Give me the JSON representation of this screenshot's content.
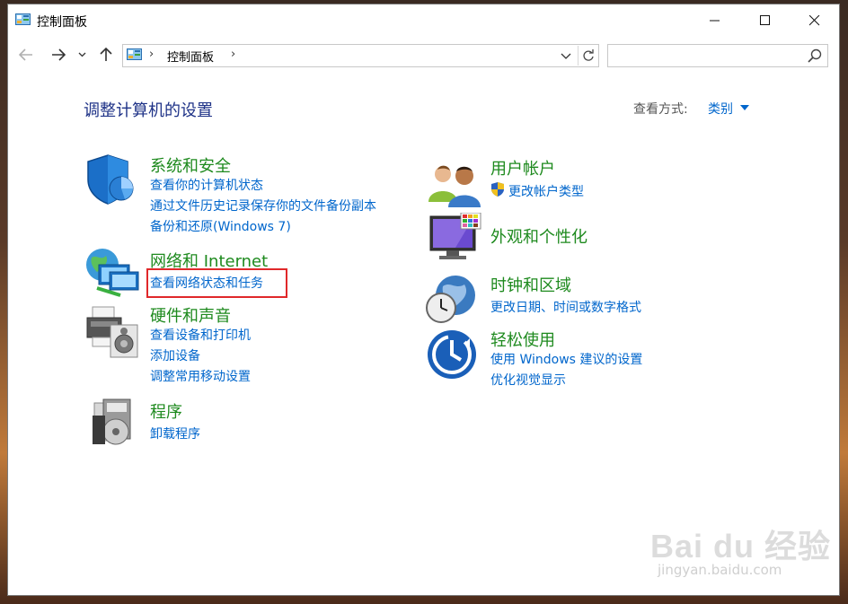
{
  "window": {
    "title": "控制面板"
  },
  "address": {
    "segment": "控制面板",
    "separator": "›"
  },
  "search": {
    "placeholder": ""
  },
  "main": {
    "heading": "调整计算机的设置",
    "view_by_label": "查看方式:",
    "view_by_value": "类别"
  },
  "categories": {
    "system": {
      "title": "系统和安全",
      "links": [
        "查看你的计算机状态",
        "通过文件历史记录保存你的文件备份副本",
        "备份和还原(Windows 7)"
      ]
    },
    "network": {
      "title": "网络和 Internet",
      "links": [
        "查看网络状态和任务"
      ]
    },
    "hardware": {
      "title": "硬件和声音",
      "links": [
        "查看设备和打印机",
        "添加设备",
        "调整常用移动设置"
      ]
    },
    "programs": {
      "title": "程序",
      "links": [
        "卸载程序"
      ]
    },
    "users": {
      "title": "用户帐户",
      "links": [
        "更改帐户类型"
      ]
    },
    "appearance": {
      "title": "外观和个性化",
      "links": []
    },
    "clock": {
      "title": "时钟和区域",
      "links": [
        "更改日期、时间或数字格式"
      ]
    },
    "ease": {
      "title": "轻松使用",
      "links": [
        "使用 Windows 建议的设置",
        "优化视觉显示"
      ]
    }
  },
  "watermark": {
    "brand": "Bai du 经验",
    "url": "jingyan.baidu.com"
  },
  "colors": {
    "link": "#0066cc",
    "category": "#1e8a1e",
    "heading": "#1e3287",
    "highlight": "#e0282a"
  }
}
